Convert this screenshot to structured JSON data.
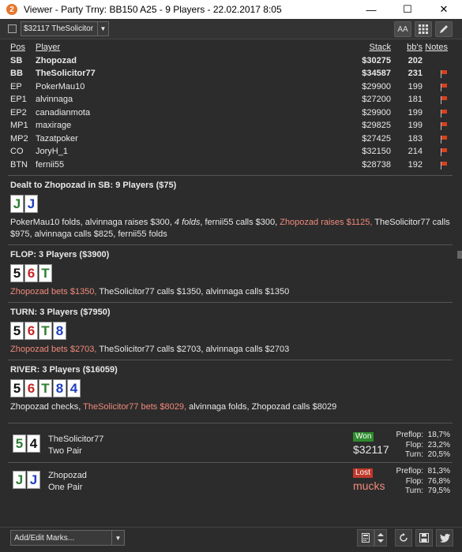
{
  "window": {
    "title": "Viewer - Party Trny: BB150 A25 - 9 Players - 22.02.2017 8:05",
    "app_icon": "2",
    "minimize": "—",
    "maximize": "☐",
    "close": "✕"
  },
  "toolbar": {
    "hand_select_value": "$32117 TheSolicitor",
    "font_button": "AA",
    "grid_icon": "grid-icon",
    "edit_icon": "pencil-icon"
  },
  "players": {
    "headers": {
      "pos": "Pos",
      "player": "Player",
      "stack": "Stack",
      "bbs": "bb's",
      "notes": "Notes"
    },
    "rows": [
      {
        "pos": "SB",
        "name": "Zhopozad",
        "stack": "$30275",
        "bbs": "202",
        "bold": true,
        "flag": false
      },
      {
        "pos": "BB",
        "name": "TheSolicitor77",
        "stack": "$34587",
        "bbs": "231",
        "bold": true,
        "flag": true
      },
      {
        "pos": "EP",
        "name": "PokerMau10",
        "stack": "$29900",
        "bbs": "199",
        "bold": false,
        "flag": true
      },
      {
        "pos": "EP1",
        "name": "alvinnaga",
        "stack": "$27200",
        "bbs": "181",
        "bold": false,
        "flag": true
      },
      {
        "pos": "EP2",
        "name": "canadianmota",
        "stack": "$29900",
        "bbs": "199",
        "bold": false,
        "flag": true
      },
      {
        "pos": "MP1",
        "name": "maxirage",
        "stack": "$29825",
        "bbs": "199",
        "bold": false,
        "flag": true
      },
      {
        "pos": "MP2",
        "name": "Tazatpoker",
        "stack": "$27425",
        "bbs": "183",
        "bold": false,
        "flag": true
      },
      {
        "pos": "CO",
        "name": "JoryH_1",
        "stack": "$32150",
        "bbs": "214",
        "bold": false,
        "flag": true
      },
      {
        "pos": "BTN",
        "name": "fernii55",
        "stack": "$28738",
        "bbs": "192",
        "bold": false,
        "flag": true
      }
    ]
  },
  "preflop": {
    "title": "Dealt to Zhopozad in SB: 9 Players ($75)",
    "cards": [
      {
        "rank": "J",
        "suit": "c"
      },
      {
        "rank": "J",
        "suit": "d"
      }
    ],
    "action_part1": "PokerMau10 folds, alvinnaga raises $300, ",
    "action_folds": "4 folds",
    "action_part2": ", fernii55 calls $300, ",
    "action_hero": "Zhopozad raises $1125,",
    "action_part3": " TheSolicitor77 calls $975, alvinnaga calls $825, fernii55 folds"
  },
  "flop": {
    "title": "FLOP: 3 Players ($3900)",
    "cards": [
      {
        "rank": "5",
        "suit": "s"
      },
      {
        "rank": "6",
        "suit": "h"
      },
      {
        "rank": "T",
        "suit": "c"
      }
    ],
    "action_hero": "Zhopozad bets $1350,",
    "action_rest": " TheSolicitor77 calls $1350, alvinnaga calls $1350"
  },
  "turn": {
    "title": "TURN: 3 Players ($7950)",
    "cards": [
      {
        "rank": "5",
        "suit": "s"
      },
      {
        "rank": "6",
        "suit": "h"
      },
      {
        "rank": "T",
        "suit": "c"
      },
      {
        "rank": "8",
        "suit": "d"
      }
    ],
    "action_hero": "Zhopozad bets $2703,",
    "action_rest": " TheSolicitor77 calls $2703, alvinnaga calls $2703"
  },
  "river": {
    "title": "RIVER: 3 Players ($16059)",
    "cards": [
      {
        "rank": "5",
        "suit": "s"
      },
      {
        "rank": "6",
        "suit": "h"
      },
      {
        "rank": "T",
        "suit": "c"
      },
      {
        "rank": "8",
        "suit": "d"
      },
      {
        "rank": "4",
        "suit": "d"
      }
    ],
    "action_part1": "Zhopozad checks, ",
    "action_hero": "TheSolicitor77 bets $8029,",
    "action_part2": " alvinnaga folds, Zhopozad calls $8029"
  },
  "showdown": [
    {
      "cards": [
        {
          "rank": "5",
          "suit": "c"
        },
        {
          "rank": "4",
          "suit": "s"
        }
      ],
      "name": "TheSolicitor77",
      "hand": "Two Pair",
      "result": "Won",
      "amount": "$32117",
      "stats": [
        {
          "label": "Preflop:",
          "value": "18,7%"
        },
        {
          "label": "Flop:",
          "value": "23,2%"
        },
        {
          "label": "Turn:",
          "value": "20,5%"
        }
      ]
    },
    {
      "cards": [
        {
          "rank": "J",
          "suit": "c"
        },
        {
          "rank": "J",
          "suit": "d"
        }
      ],
      "name": "Zhopozad",
      "hand": "One Pair",
      "result": "Lost",
      "amount": "mucks",
      "stats": [
        {
          "label": "Preflop:",
          "value": "81,3%"
        },
        {
          "label": "Flop:",
          "value": "76,8%"
        },
        {
          "label": "Turn:",
          "value": "79,5%"
        }
      ]
    }
  ],
  "bottombar": {
    "marks_placeholder": "Add/Edit Marks...",
    "icons": [
      "calculator-icon",
      "sort-icon",
      "refresh-icon",
      "save-icon",
      "twitter-icon"
    ]
  },
  "colors": {
    "hero_action": "#f08a7c",
    "won_badge": "#2e8b2e",
    "lost_badge": "#c0392b",
    "background": "#2c2c2c"
  }
}
